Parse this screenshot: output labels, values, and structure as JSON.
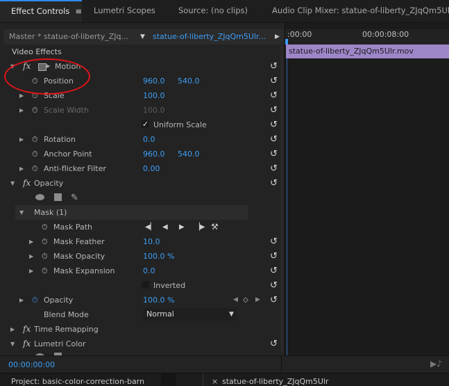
{
  "tabs": [
    {
      "label": "Effect Controls",
      "menu": "≡"
    },
    {
      "label": "Lumetri Scopes"
    },
    {
      "label": "Source: (no clips)"
    },
    {
      "label": "Audio Clip Mixer: statue-of-liberty_ZJqQm5Ulr"
    }
  ],
  "header": {
    "master": "Master * statue-of-liberty_ZJq...",
    "clip": "statue-of-liberty_ZJqQm5Ulr..."
  },
  "section": "Video Effects",
  "motion": {
    "name": "Motion",
    "position": {
      "label": "Position",
      "x": "960.0",
      "y": "540.0"
    },
    "scale": {
      "label": "Scale",
      "value": "100.0"
    },
    "scale_width": {
      "label": "Scale Width",
      "value": "100.0"
    },
    "uniform_scale": {
      "label": "Uniform Scale",
      "check": "✓"
    },
    "rotation": {
      "label": "Rotation",
      "value": "0.0"
    },
    "anchor": {
      "label": "Anchor Point",
      "x": "960.0",
      "y": "540.0"
    },
    "antiflicker": {
      "label": "Anti-flicker Filter",
      "value": "0.00"
    }
  },
  "opacity_fx": {
    "name": "Opacity",
    "mask": {
      "name": "Mask (1)",
      "path_label": "Mask Path",
      "feather": {
        "label": "Mask Feather",
        "value": "10.0"
      },
      "opacity": {
        "label": "Mask Opacity",
        "value": "100.0 %"
      },
      "expansion": {
        "label": "Mask Expansion",
        "value": "0.0"
      },
      "inverted": "Inverted"
    },
    "opacity": {
      "label": "Opacity",
      "value": "100.0 %"
    },
    "blend": {
      "label": "Blend Mode",
      "value": "Normal"
    }
  },
  "time_remap": "Time Remapping",
  "lumetri": "Lumetri Color",
  "timeline": {
    "t0": ":00:00",
    "t1": "00:00:08:00",
    "clip": "statue-of-liberty_ZJqQm5Ulr.mov",
    "clip_color": "#9e87c9"
  },
  "footer_time": "00:00:00:00",
  "bottom_tabs": [
    {
      "label": "Project: basic-color-correction-barn"
    },
    {
      "label": "statue-of-liberty_ZJqQm5Ulr"
    }
  ],
  "colors": {
    "accent": "#3d9ef5",
    "annotation": "#e0141a",
    "active_tab": "#2d8ceb"
  }
}
